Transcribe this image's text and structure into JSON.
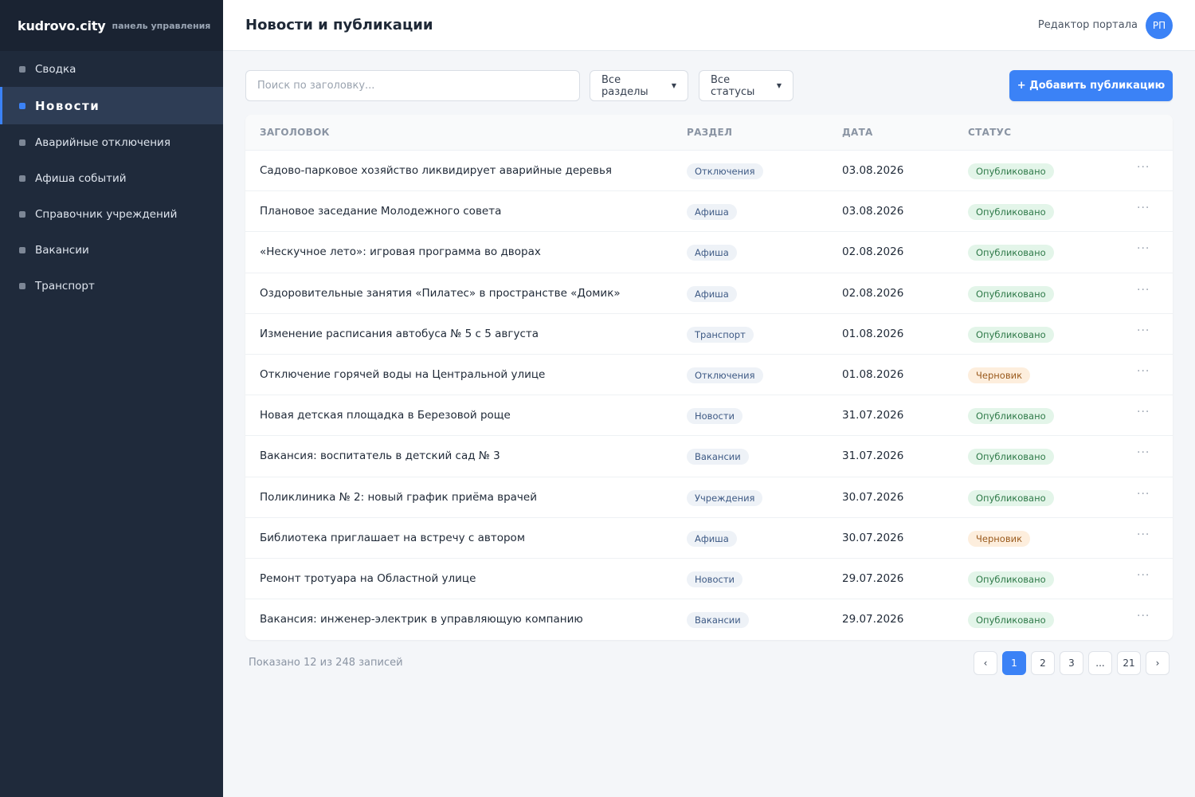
{
  "brand": {
    "name": "kudrovo.city",
    "subtitle": "панель управления"
  },
  "sidebar": {
    "items": [
      {
        "label": "Сводка",
        "active": false
      },
      {
        "label": "Новости",
        "active": true
      },
      {
        "label": "Аварийные отключения",
        "active": false
      },
      {
        "label": "Афиша событий",
        "active": false
      },
      {
        "label": "Справочник учреждений",
        "active": false
      },
      {
        "label": "Вакансии",
        "active": false
      },
      {
        "label": "Транспорт",
        "active": false
      }
    ]
  },
  "header": {
    "title": "Новости и публикации",
    "user_name": "Редактор портала",
    "user_initials": "РП"
  },
  "toolbar": {
    "search_placeholder": "Поиск по заголовку...",
    "section_filter": "Все разделы",
    "status_filter": "Все статусы",
    "add_button": "+ Добавить публикацию"
  },
  "table": {
    "columns": {
      "title": "ЗАГОЛОВОК",
      "section": "РАЗДЕЛ",
      "date": "ДАТА",
      "status": "СТАТУС"
    },
    "rows": [
      {
        "title": "Садово-парковое хозяйство ликвидирует аварийные деревья",
        "section": "Отключения",
        "date": "03.08.2026",
        "status": "Опубликовано",
        "status_kind": "pub"
      },
      {
        "title": "Плановое заседание Молодежного совета",
        "section": "Афиша",
        "date": "03.08.2026",
        "status": "Опубликовано",
        "status_kind": "pub"
      },
      {
        "title": "«Нескучное лето»: игровая программа во дворах",
        "section": "Афиша",
        "date": "02.08.2026",
        "status": "Опубликовано",
        "status_kind": "pub"
      },
      {
        "title": "Оздоровительные занятия «Пилатес» в пространстве «Домик»",
        "section": "Афиша",
        "date": "02.08.2026",
        "status": "Опубликовано",
        "status_kind": "pub"
      },
      {
        "title": "Изменение расписания автобуса № 5 с 5 августа",
        "section": "Транспорт",
        "date": "01.08.2026",
        "status": "Опубликовано",
        "status_kind": "pub"
      },
      {
        "title": "Отключение горячей воды на Центральной улице",
        "section": "Отключения",
        "date": "01.08.2026",
        "status": "Черновик",
        "status_kind": "draft"
      },
      {
        "title": "Новая детская площадка в Березовой роще",
        "section": "Новости",
        "date": "31.07.2026",
        "status": "Опубликовано",
        "status_kind": "pub"
      },
      {
        "title": "Вакансия: воспитатель в детский сад № 3",
        "section": "Вакансии",
        "date": "31.07.2026",
        "status": "Опубликовано",
        "status_kind": "pub"
      },
      {
        "title": "Поликлиника № 2: новый график приёма врачей",
        "section": "Учреждения",
        "date": "30.07.2026",
        "status": "Опубликовано",
        "status_kind": "pub"
      },
      {
        "title": "Библиотека приглашает на встречу с автором",
        "section": "Афиша",
        "date": "30.07.2026",
        "status": "Черновик",
        "status_kind": "draft"
      },
      {
        "title": "Ремонт тротуара на Областной улице",
        "section": "Новости",
        "date": "29.07.2026",
        "status": "Опубликовано",
        "status_kind": "pub"
      },
      {
        "title": "Вакансия: инженер-электрик в управляющую компанию",
        "section": "Вакансии",
        "date": "29.07.2026",
        "status": "Опубликовано",
        "status_kind": "pub"
      }
    ],
    "row_menu": "···"
  },
  "footer": {
    "summary": "Показано 12 из 248 записей",
    "pages": [
      {
        "label": "‹",
        "active": false
      },
      {
        "label": "1",
        "active": true
      },
      {
        "label": "2",
        "active": false
      },
      {
        "label": "3",
        "active": false
      },
      {
        "label": "...",
        "active": false
      },
      {
        "label": "21",
        "active": false
      },
      {
        "label": "›",
        "active": false
      }
    ]
  },
  "colors": {
    "accent": "#3b82f6",
    "sidebar": "#1f2a3b",
    "published": "#2f7a49",
    "draft": "#9a5a1d"
  }
}
